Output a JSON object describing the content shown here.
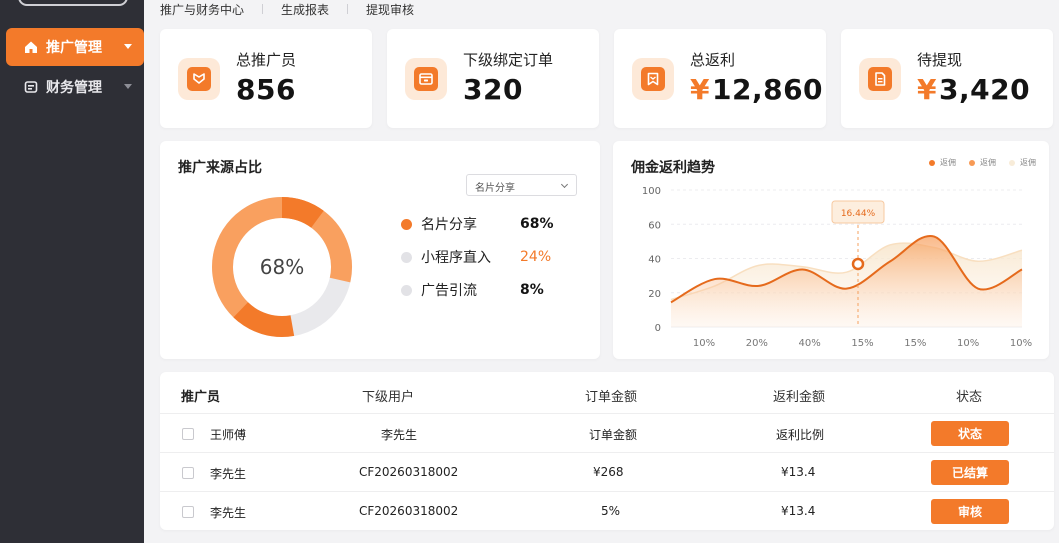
{
  "sidebar": {
    "items": [
      {
        "label": "推广管理",
        "active": true
      },
      {
        "label": "财务管理",
        "active": false
      }
    ]
  },
  "topnav": [
    "推广与财务中心",
    "生成报表",
    "提现审核"
  ],
  "stats": [
    {
      "label": "总推广员",
      "value": "856",
      "currency": "",
      "icon": "badge-check-icon"
    },
    {
      "label": "下级绑定订单",
      "value": "320",
      "currency": "",
      "icon": "wallet-icon"
    },
    {
      "label": "总返利",
      "value": "12,860",
      "currency": "¥",
      "icon": "bookmark-icon"
    },
    {
      "label": "待提现",
      "value": "3,420",
      "currency": "¥",
      "icon": "document-icon"
    }
  ],
  "source_panel": {
    "title": "推广来源占比",
    "dropdown": "名片分享",
    "center_label": "68%",
    "legend": [
      {
        "name": "名片分享",
        "pct": "68%",
        "dot": "#f37a2a",
        "pct_color": "#141414"
      },
      {
        "name": "小程序直入",
        "pct": "24%",
        "dot": "#e2e2e6",
        "pct_color": "#f37a2a"
      },
      {
        "name": "广告引流",
        "pct": "8%",
        "dot": "#e2e2e6",
        "pct_color": "#141414"
      }
    ]
  },
  "trend_panel": {
    "title": "佣金返利趋势",
    "legend": [
      {
        "name": "返佣",
        "color": "#f37a2a"
      },
      {
        "name": "返佣",
        "color": "#f79a55"
      },
      {
        "name": "返佣",
        "color": "#f8ecd9"
      }
    ],
    "tooltip": "16.44%"
  },
  "chart_data": {
    "type": "area",
    "x": [
      "10%",
      "20%",
      "40%",
      "15%",
      "15%",
      "10%",
      "10%"
    ],
    "ylim": [
      0,
      100
    ],
    "yticks": [
      "100",
      "60",
      "40",
      "20",
      "0"
    ],
    "series": [
      {
        "values": [
          18,
          35,
          30,
          42,
          28,
          48,
          66,
          28,
          42
        ]
      },
      {
        "values": [
          20,
          30,
          45,
          44,
          40,
          60,
          58,
          48,
          56
        ]
      }
    ],
    "highlight": {
      "x_index": 3,
      "value": 46
    }
  },
  "table": {
    "headers": [
      "推广员",
      "下级用户",
      "订单金额",
      "返利金额",
      "状态"
    ],
    "rows": [
      {
        "promoter": "王师傅",
        "user": "李先生",
        "amount": "订单金额",
        "rebate": "返利比例",
        "status": "状态"
      },
      {
        "promoter": "李先生",
        "user": "CF20260318002",
        "amount": "¥268",
        "rebate": "¥13.4",
        "status": "已结算"
      },
      {
        "promoter": "李先生",
        "user": "CF20260318002",
        "amount": "5%",
        "rebate": "¥13.4",
        "status": "审核"
      }
    ]
  },
  "colors": {
    "accent": "#f37a2a",
    "sidebar": "#2e2f36"
  }
}
